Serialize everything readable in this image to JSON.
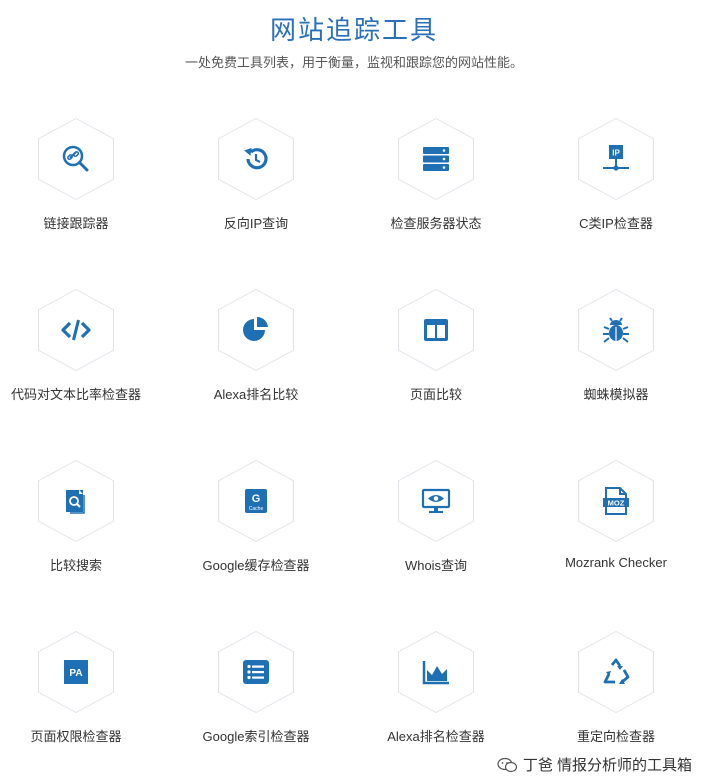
{
  "header": {
    "title": "网站追踪工具",
    "subtitle": "一处免费工具列表，用于衡量，监视和跟踪您的网站性能。"
  },
  "tools": [
    {
      "label": "链接跟踪器",
      "icon": "link-search-icon"
    },
    {
      "label": "反向IP查询",
      "icon": "reverse-arrow-icon"
    },
    {
      "label": "检查服务器状态",
      "icon": "server-icon"
    },
    {
      "label": "C类IP检查器",
      "icon": "ip-network-icon"
    },
    {
      "label": "代码对文本比率检查器",
      "icon": "code-icon"
    },
    {
      "label": "Alexa排名比较",
      "icon": "pie-chart-icon"
    },
    {
      "label": "页面比较",
      "icon": "columns-icon"
    },
    {
      "label": "蜘蛛模拟器",
      "icon": "bug-icon"
    },
    {
      "label": "比较搜索",
      "icon": "document-search-icon"
    },
    {
      "label": "Google缓存检查器",
      "icon": "google-cache-icon"
    },
    {
      "label": "Whois查询",
      "icon": "monitor-eye-icon"
    },
    {
      "label": "Mozrank Checker",
      "icon": "moz-file-icon"
    },
    {
      "label": "页面权限检查器",
      "icon": "pa-badge-icon"
    },
    {
      "label": "Google索引检查器",
      "icon": "list-icon"
    },
    {
      "label": "Alexa排名检查器",
      "icon": "area-chart-icon"
    },
    {
      "label": "重定向检查器",
      "icon": "recycle-icon"
    }
  ],
  "badge_text": {
    "ip": "IP",
    "google_g": "G",
    "cache": "Cache",
    "moz": "MOZ",
    "pa": "PA"
  },
  "watermark": {
    "text": "丁爸 情报分析师的工具箱"
  },
  "colors": {
    "accent": "#2a6fb8",
    "icon_blue": "#1f6fb5",
    "hex_border": "#dfe3e8"
  }
}
